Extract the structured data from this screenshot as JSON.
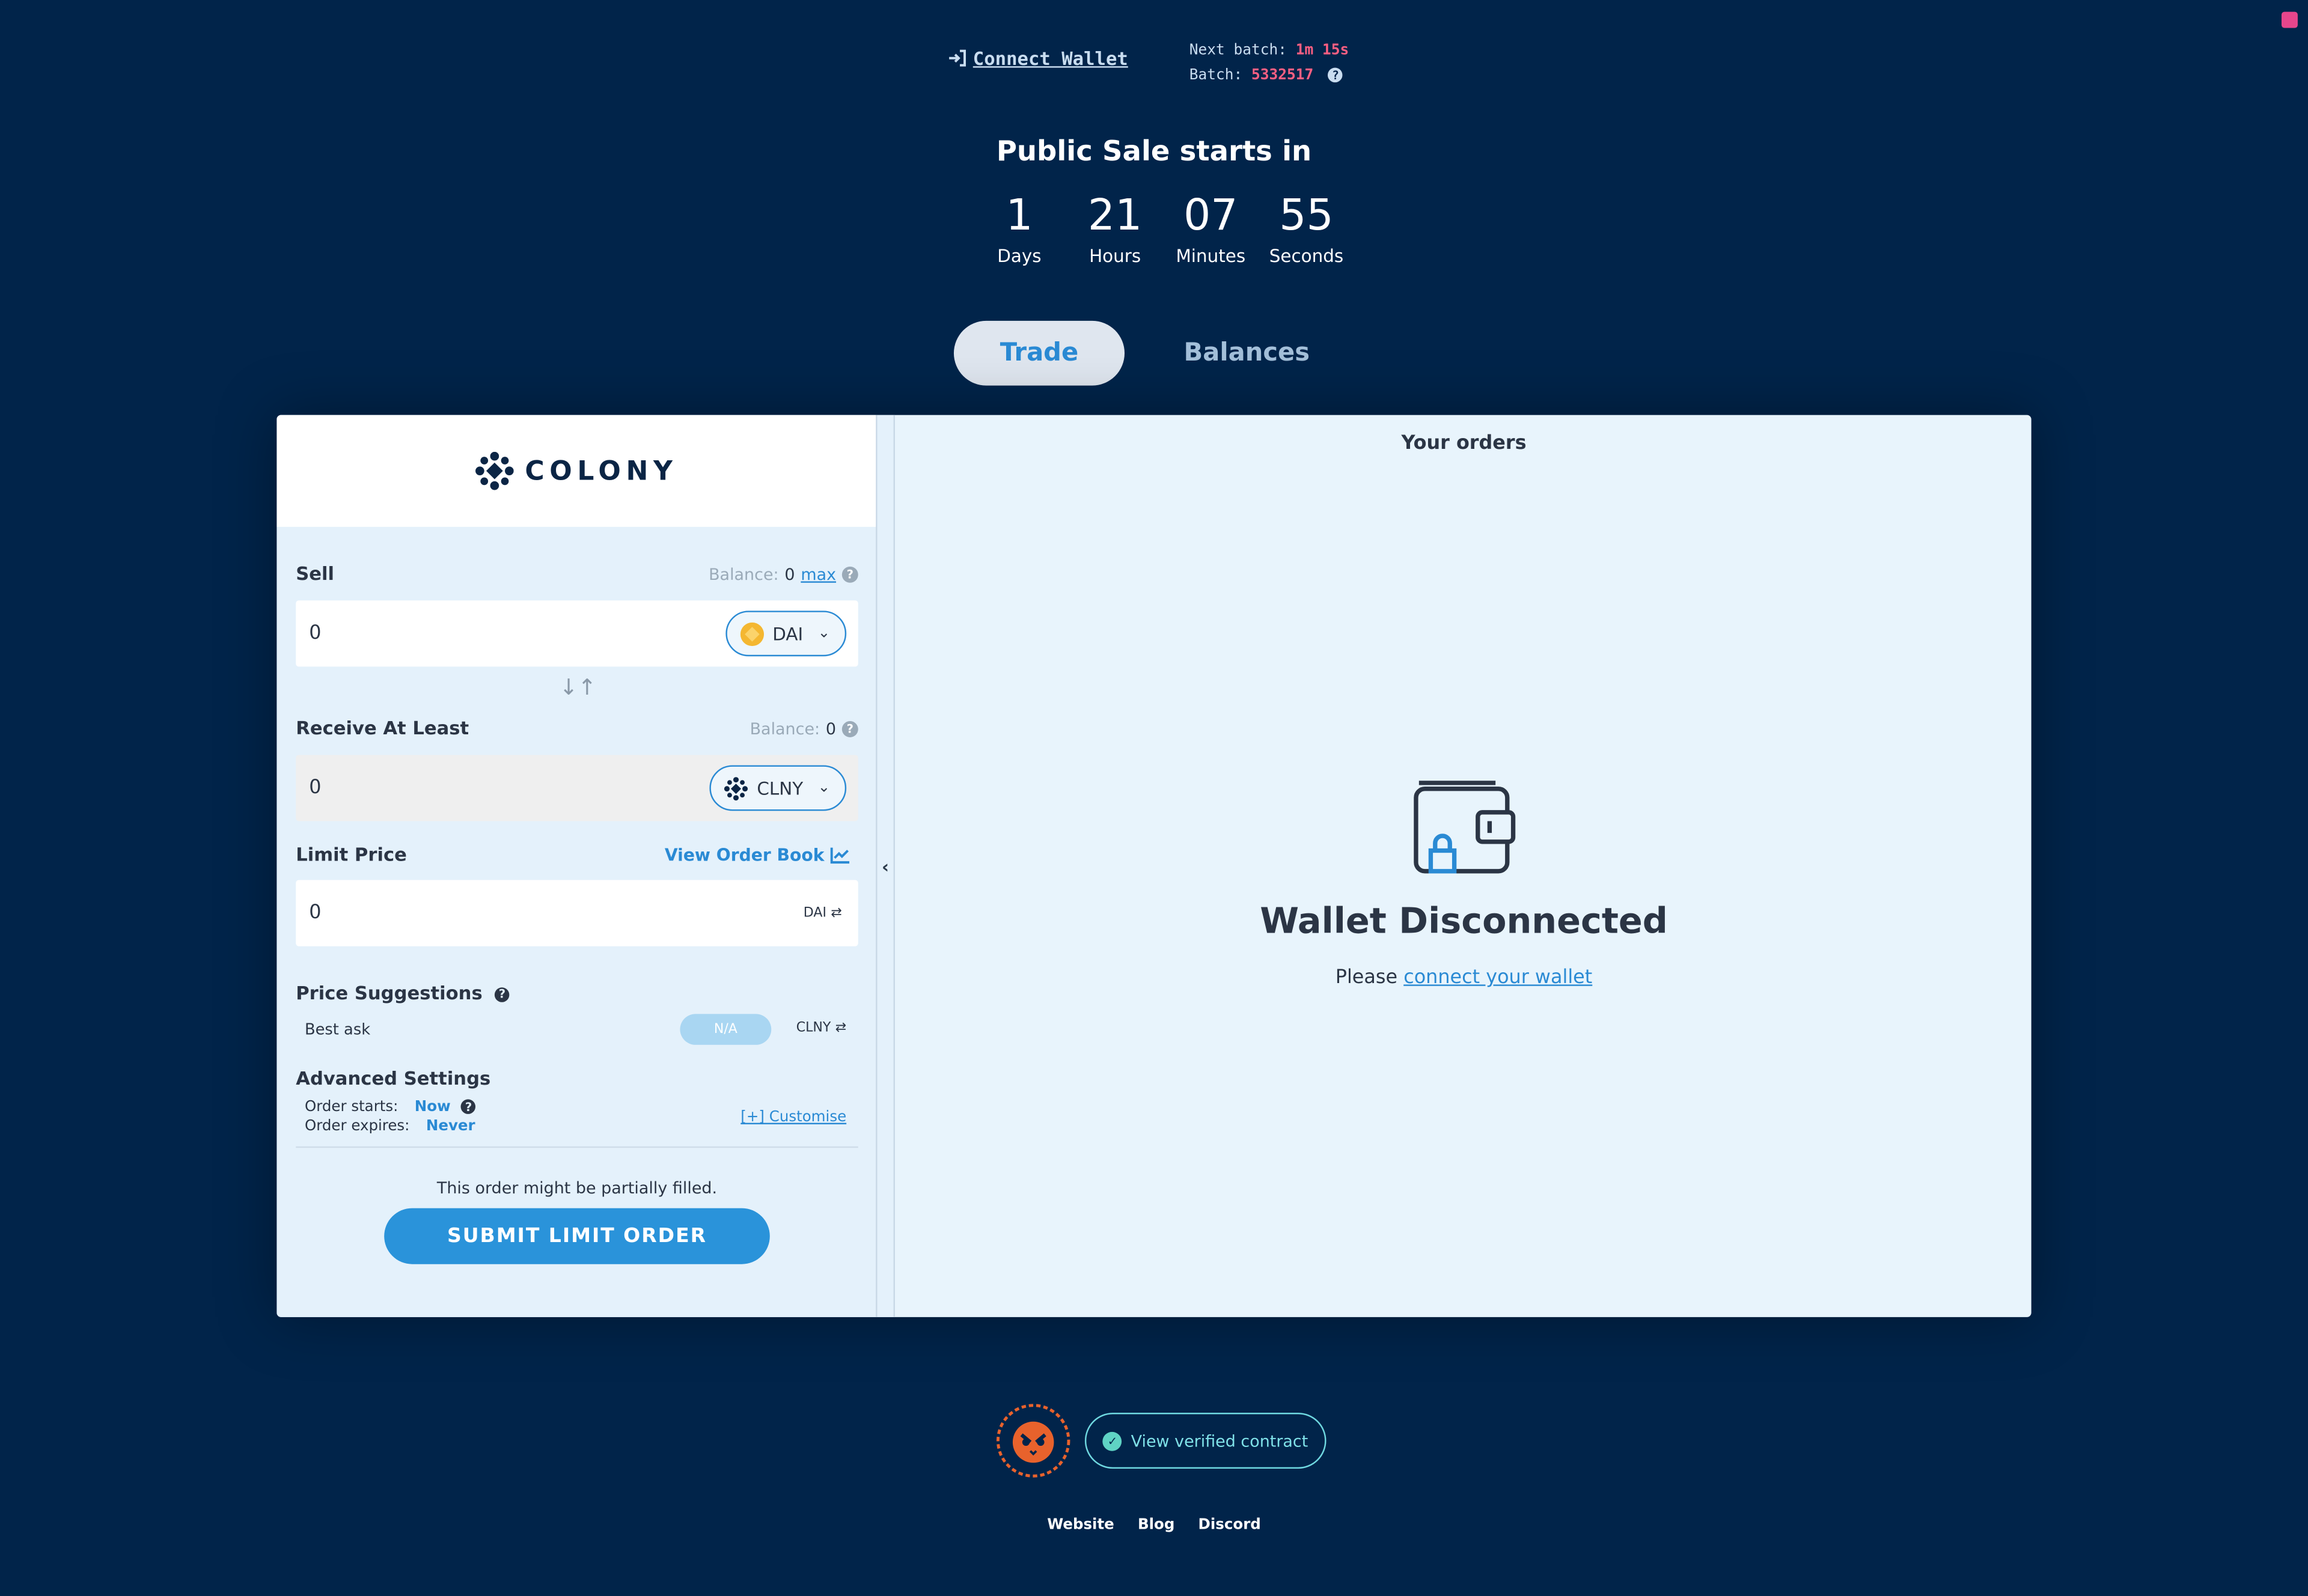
{
  "header": {
    "connect_wallet_label": "Connect Wallet",
    "next_batch_label": "Next batch:",
    "next_batch_value": "1m 15s",
    "batch_label": "Batch:",
    "batch_value": "5332517"
  },
  "sale": {
    "title": "Public Sale starts in",
    "countdown": [
      {
        "value": "1",
        "unit": "Days"
      },
      {
        "value": "21",
        "unit": "Hours"
      },
      {
        "value": "07",
        "unit": "Minutes"
      },
      {
        "value": "55",
        "unit": "Seconds"
      }
    ]
  },
  "tabs": [
    {
      "label": "Trade",
      "active": true
    },
    {
      "label": "Balances",
      "active": false
    }
  ],
  "trade_form": {
    "logo_text": "COLONY",
    "sell": {
      "label": "Sell",
      "balance_label": "Balance:",
      "balance_value": "0",
      "max_label": "max",
      "amount": "0",
      "token": "DAI"
    },
    "receive": {
      "label": "Receive At Least",
      "balance_label": "Balance:",
      "balance_value": "0",
      "amount": "0",
      "token": "CLNY"
    },
    "limit_price": {
      "label": "Limit Price",
      "view_order_book_label": "View Order Book",
      "value": "0",
      "unit": "DAI"
    },
    "price_suggestions": {
      "label": "Price Suggestions",
      "best_ask_label": "Best ask",
      "best_ask_value": "N/A",
      "unit": "CLNY"
    },
    "advanced": {
      "label": "Advanced Settings",
      "order_starts_label": "Order starts:",
      "order_starts_value": "Now",
      "order_expires_label": "Order expires:",
      "order_expires_value": "Never",
      "customise_label": "[+] Customise"
    },
    "partial_note": "This order might be partially filled.",
    "submit_label": "SUBMIT LIMIT ORDER"
  },
  "orders": {
    "title": "Your orders",
    "empty_title": "Wallet Disconnected",
    "empty_prefix": "Please",
    "empty_link": "connect your wallet"
  },
  "footer": {
    "verified_label": "View verified contract",
    "links": [
      "Website",
      "Blog",
      "Discord"
    ]
  },
  "colors": {
    "background": "#01244a",
    "accent": "#2a93da",
    "alert": "#ff5f82",
    "teal": "#7fe1e8"
  }
}
